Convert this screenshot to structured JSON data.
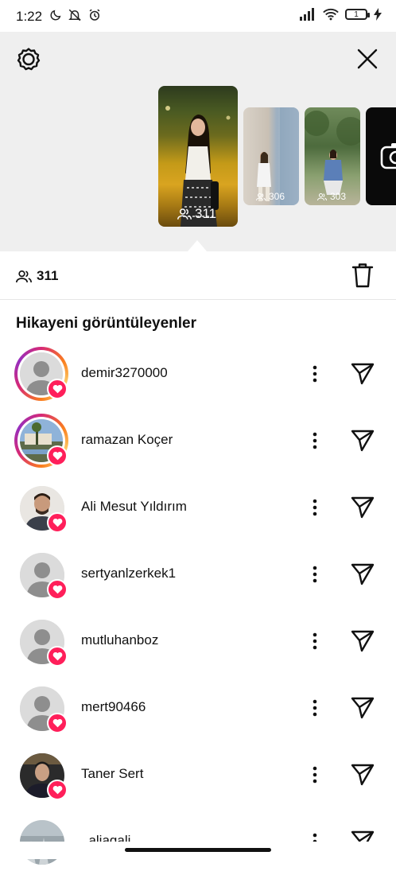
{
  "status_bar": {
    "time": "1:22",
    "battery": "1"
  },
  "story_strip": {
    "main_count": "311",
    "thumbs": [
      {
        "count": "306"
      },
      {
        "count": "303"
      }
    ]
  },
  "summary": {
    "viewer_count": "311"
  },
  "viewers_title": "Hikayeni görüntüleyenler",
  "viewers": [
    {
      "name": "demir3270000",
      "ring": "gradient",
      "avatar": "default"
    },
    {
      "name": "ramazan Koçer",
      "ring": "gradient",
      "avatar": "photo-landscape"
    },
    {
      "name": "Ali Mesut Yıldırım",
      "ring": "none",
      "avatar": "photo-man"
    },
    {
      "name": "sertyanlzerkek1",
      "ring": "none",
      "avatar": "default"
    },
    {
      "name": "mutluhanboz",
      "ring": "none",
      "avatar": "default"
    },
    {
      "name": "mert90466",
      "ring": "none",
      "avatar": "default"
    },
    {
      "name": "Taner Sert",
      "ring": "none",
      "avatar": "photo-man-dark"
    },
    {
      "name": "_aliagali",
      "ring": "none",
      "avatar": "photo-partial"
    }
  ],
  "colors": {
    "heart_badge": "#ff1f5a",
    "panel_bg": "#efefef"
  }
}
